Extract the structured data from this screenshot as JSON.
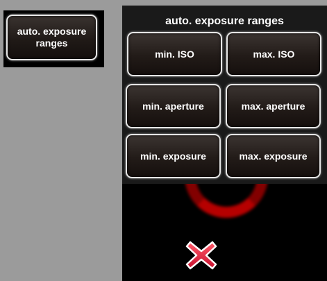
{
  "toolbar": {
    "auto_exposure_button_label": "auto. exposure ranges"
  },
  "popup": {
    "title": "auto. exposure ranges",
    "buttons": [
      {
        "label": "min. ISO"
      },
      {
        "label": "max. ISO"
      },
      {
        "label": "min. aperture"
      },
      {
        "label": "max. aperture"
      },
      {
        "label": "min. exposure"
      },
      {
        "label": "max. exposure"
      }
    ]
  },
  "close": {
    "icon": "close-icon",
    "color": "#e8283c"
  },
  "colors": {
    "background": "#9b9b9b",
    "panel": "#000000",
    "popup": "#1a1a1a",
    "button_border": "#e6e6e6"
  }
}
